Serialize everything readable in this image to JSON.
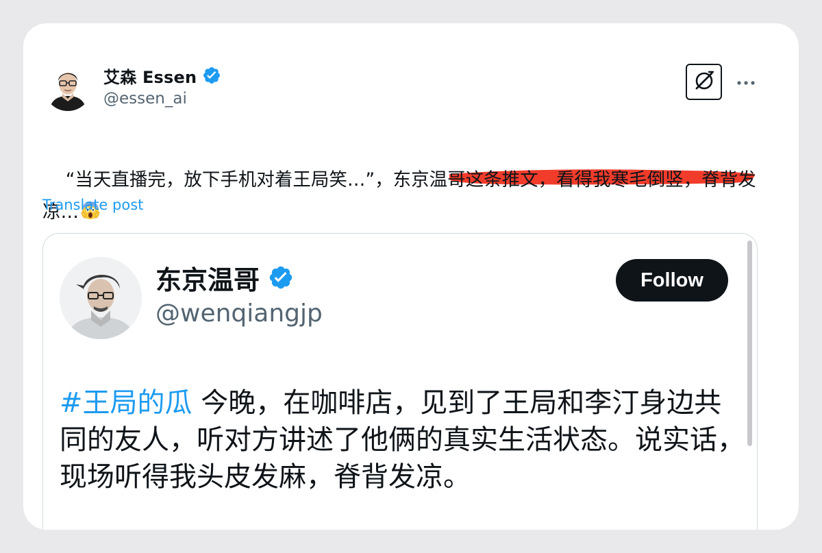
{
  "post": {
    "author": {
      "display_name": "艾森 Essen",
      "handle": "@essen_ai",
      "verified": true
    },
    "text": "“当天直播完，放下手机对着王局笑…”，东京温哥这条推文，看得我寒毛倒竖，脊背发凉…",
    "emoji": "face-screaming-in-fear",
    "translate_label": "Translate post",
    "annotation_color": "#f23c2b"
  },
  "header_icons": {
    "grok": "grok-icon",
    "more": "more-icon"
  },
  "quoted_post": {
    "author": {
      "display_name": "东京温哥",
      "handle": "@wenqiangjp",
      "verified": true
    },
    "follow_label": "Follow",
    "hashtag": "#王局的瓜",
    "text": " 今晚，在咖啡店，见到了王局和李汀身边共同的友人，听对方讲述了他俩的真实生活状态。说实话，现场听得我头皮发麻，脊背发凉。"
  },
  "colors": {
    "link": "#1d9bf0",
    "verified": "#1d9bf0",
    "text": "#0f1419",
    "secondary": "#536471"
  }
}
